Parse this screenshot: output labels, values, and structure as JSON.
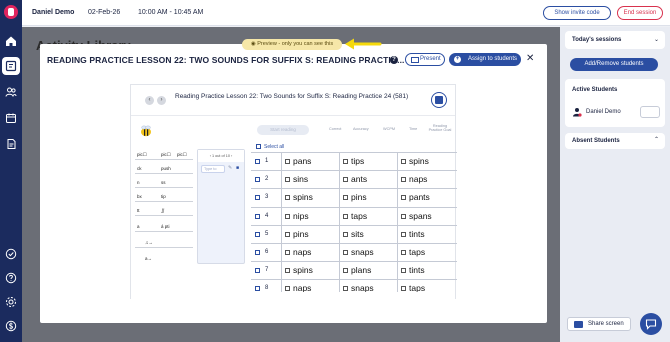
{
  "topbar": {
    "user_name": "Daniel Demo",
    "date": "02-Feb-26",
    "time_range": "10:00 AM - 10:45 AM",
    "invite_label": "Show invite code",
    "end_label": "End session"
  },
  "background": {
    "page_title": "Activity Library"
  },
  "sidebar": {
    "icons": [
      "home-icon",
      "classroom-icon",
      "people-icon",
      "calendar-icon",
      "document-icon",
      "check-icon",
      "help-icon",
      "settings-icon",
      "dollar-icon"
    ]
  },
  "preview": {
    "label": "Preview - only you can see this"
  },
  "modal": {
    "title": "READING PRACTICE LESSON 22: TWO SOUNDS FOR SUFFIX S: READING PRACTIC...",
    "help": "?",
    "present_label": "Present",
    "assign_label": "Assign to students",
    "close": "✕"
  },
  "resource": {
    "title": "Reading Practice Lesson 22: Two Sounds for Suffix S: Reading Practice 24 (581)",
    "prev": "‹",
    "next": "›",
    "start_label": "Start reading",
    "headers": [
      "Correct",
      "Accuracy",
      "WCPM",
      "Time",
      "Reading Practice Goal"
    ],
    "side_rows": [
      [
        "pic☐",
        "pic☐",
        "pic☐"
      ],
      [
        "ck",
        "push"
      ],
      [
        "n",
        "ss"
      ],
      [
        "bx",
        "tip"
      ],
      [
        "tt",
        "∬"
      ],
      [
        "a",
        "á pti"
      ],
      [
        "♫→",
        ""
      ],
      [
        "a→",
        ""
      ]
    ],
    "mini_panel": {
      "pager": "1 out of 10",
      "type_label": "Type to"
    },
    "select_all": "Select all",
    "rows": [
      {
        "num": "1",
        "words": [
          "pans",
          "tips",
          "spins"
        ]
      },
      {
        "num": "2",
        "words": [
          "sins",
          "ants",
          "naps"
        ]
      },
      {
        "num": "3",
        "words": [
          "spins",
          "pins",
          "pants"
        ]
      },
      {
        "num": "4",
        "words": [
          "nips",
          "taps",
          "spans"
        ]
      },
      {
        "num": "5",
        "words": [
          "pins",
          "sits",
          "tints"
        ]
      },
      {
        "num": "6",
        "words": [
          "naps",
          "snaps",
          "taps"
        ]
      },
      {
        "num": "7",
        "words": [
          "spins",
          "plans",
          "tints"
        ]
      },
      {
        "num": "8",
        "words": [
          "naps",
          "snaps",
          "taps"
        ]
      }
    ]
  },
  "right_panel": {
    "todays_sessions": "Today's sessions",
    "add_remove": "Add/Remove students",
    "active_students": "Active Students",
    "student_name": "Daniel Demo",
    "absent_students": "Absent Students",
    "share_screen": "Share screen"
  },
  "colors": {
    "primary": "#2b4ea2",
    "sidebar": "#1b2b5e",
    "danger": "#d8324e",
    "preview_bg": "#f6e7a8",
    "arrow": "#f5d90c"
  }
}
